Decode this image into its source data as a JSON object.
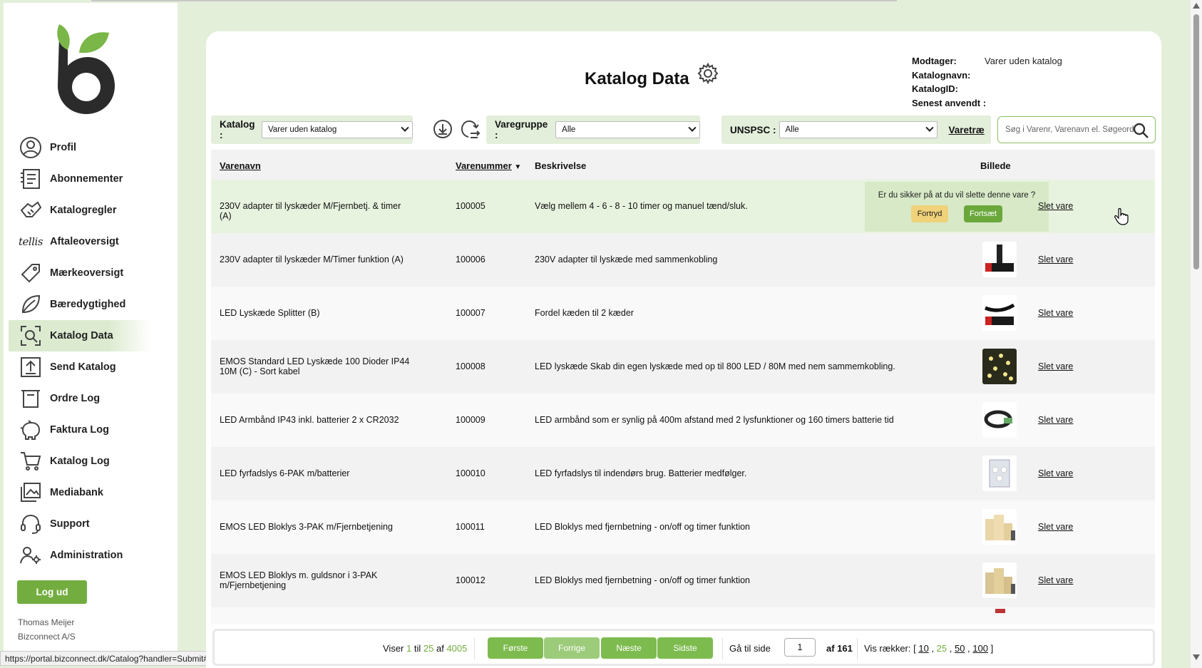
{
  "status_url": "https://portal.bizconnect.dk/Catalog?handler=Submit#",
  "sidebar": {
    "items": [
      {
        "label": "Profil",
        "icon": "user-circle-icon"
      },
      {
        "label": "Abonnementer",
        "icon": "document-list-icon"
      },
      {
        "label": "Katalogregler",
        "icon": "handshake-icon"
      },
      {
        "label": "Aftaleoversigt",
        "icon": "tellis-logo-icon",
        "prefix": "tellis"
      },
      {
        "label": "Mærkeoversigt",
        "icon": "tag-icon"
      },
      {
        "label": "Bæredygtighed",
        "icon": "leaf-icon"
      },
      {
        "label": "Katalog Data",
        "icon": "catalog-search-icon",
        "active": true
      },
      {
        "label": "Send Katalog",
        "icon": "upload-icon"
      },
      {
        "label": "Ordre Log",
        "icon": "cart-box-icon"
      },
      {
        "label": "Faktura Log",
        "icon": "piggy-bank-icon"
      },
      {
        "label": "Katalog Log",
        "icon": "shopping-cart-icon"
      },
      {
        "label": "Mediabank",
        "icon": "images-icon"
      },
      {
        "label": "Support",
        "icon": "headset-icon"
      },
      {
        "label": "Administration",
        "icon": "users-gear-icon"
      }
    ],
    "logout_label": "Log ud",
    "user_name": "Thomas Meijer",
    "user_company": "Bizconnect A/S"
  },
  "header": {
    "title": "Katalog Data",
    "meta": {
      "modtager_label": "Modtager:",
      "modtager_value": "Varer uden katalog",
      "katalognavn_label": "Katalognavn:",
      "katalogid_label": "KatalogID:",
      "senest_label": "Senest anvendt :"
    }
  },
  "filters": {
    "katalog_label": "Katalog :",
    "katalog_value": "Varer uden katalog",
    "varegruppe_label": "Varegruppe :",
    "varegruppe_value": "Alle",
    "unspsc_label": "UNSPSC :",
    "unspsc_value": "Alle",
    "varetrae_label": "Varetræ",
    "search_placeholder": "Søg i Varenr, Varenavn el. Søgeord"
  },
  "table": {
    "columns": {
      "name": "Varenavn",
      "number": "Varenummer",
      "desc": "Beskrivelse",
      "image": "Billede"
    },
    "confirm": {
      "question": "Er du sikker på at du vil slette denne vare ?",
      "cancel": "Fortryd",
      "continue": "Fortsæt"
    },
    "delete_label": "Slet vare",
    "rows": [
      {
        "name": "230V adapter til lyskæder M/Fjernbetj. & timer (A)",
        "number": "100005",
        "desc": "Vælg mellem 4 - 6 - 8 - 10 timer og manuel tænd/sluk.",
        "image": "none"
      },
      {
        "name": "230V adapter til lyskæder M/Timer funktion (A)",
        "number": "100006",
        "desc": "230V adapter til lyskæde med sammenkobling",
        "image": "adapter-image"
      },
      {
        "name": "LED Lyskæde Splitter (B)",
        "number": "100007",
        "desc": "Fordel kæden til 2 kæder",
        "image": "splitter-image"
      },
      {
        "name": "EMOS Standard LED Lyskæde 100 Dioder IP44 10M (C) - Sort kabel",
        "number": "100008",
        "desc": "LED lyskæde Skab din egen lyskæde med op til 800 LED / 80M med nem sammemkobling.",
        "image": "light-chain-image"
      },
      {
        "name": "LED Armbånd IP43 inkl. batterier 2 x CR2032",
        "number": "100009",
        "desc": "LED armbånd som er synlig på 400m afstand med 2 lysfunktioner og 160 timers batterie tid",
        "image": "armband-image"
      },
      {
        "name": "LED fyrfadslys 6-PAK m/batterier",
        "number": "100010",
        "desc": "LED fyrfadslys til indendørs brug. Batterier medfølger.",
        "image": "tealight-image"
      },
      {
        "name": "EMOS LED Bloklys 3-PAK m/Fjernbetjening",
        "number": "100011",
        "desc": "LED Bloklys med fjernbetning - on/off og timer funktion",
        "image": "candles-image"
      },
      {
        "name": "EMOS LED Bloklys m. guldsnor i 3-PAK m/Fjernbetjening",
        "number": "100012",
        "desc": "LED Bloklys med fjernbetning - on/off og timer funktion",
        "image": "candles-gold-image"
      }
    ]
  },
  "pager": {
    "showing_prefix": "Viser",
    "from": "1",
    "til": "til",
    "to": "25",
    "af": "af",
    "total": "4005",
    "first": "Første",
    "prev": "Forrige",
    "next": "Næste",
    "last": "Sidste",
    "goto_label": "Gå til side",
    "page": "1",
    "of_pages": "af 161",
    "rows_label": "Vis rækker: [",
    "opt10": "10",
    "opt25": "25",
    "opt50": "50",
    "opt100": "100",
    "close_bracket": "]"
  },
  "colors": {
    "accent": "#73ad3f",
    "background": "#e4efd9",
    "confirm_bg": "#d7e9c7"
  }
}
